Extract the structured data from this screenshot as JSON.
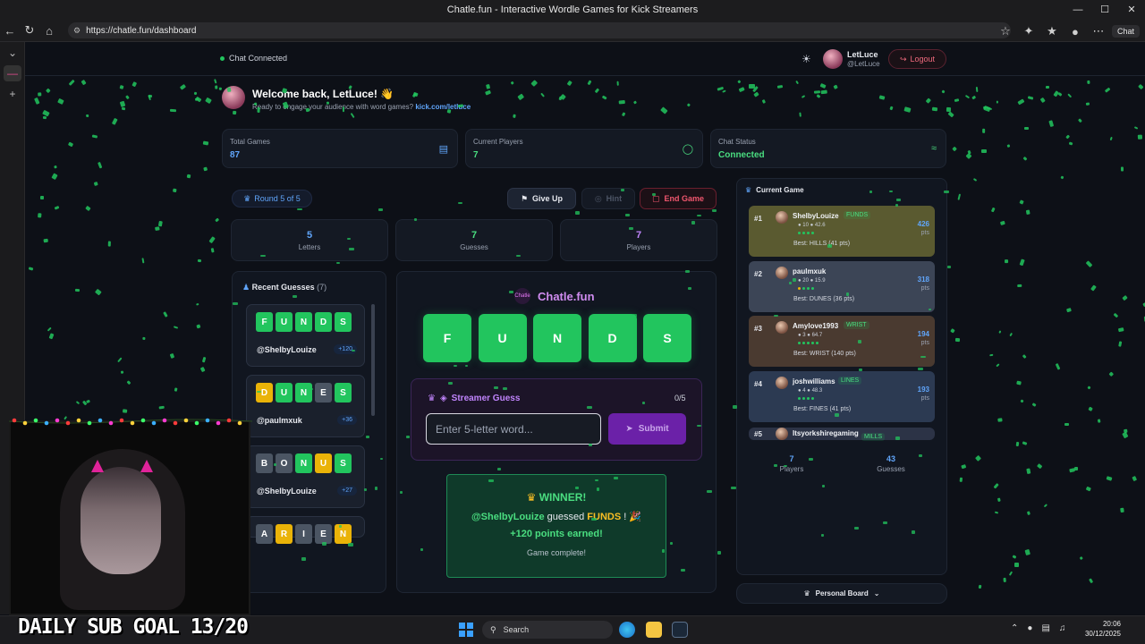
{
  "browser": {
    "window_title": "Chatle.fun - Interactive Wordle Games for Kick Streamers",
    "url": "https://chatle.fun/dashboard",
    "chat_button": "Chat",
    "window_controls": [
      "—",
      "☐",
      "✕"
    ]
  },
  "topbar": {
    "chat_status": "Chat Connected",
    "user_name": "LetLuce",
    "user_handle": "@LetLuce",
    "logout_label": "Logout"
  },
  "welcome": {
    "title": "Welcome back, LetLuce! 👋",
    "subtitle": "Ready to engage your audience with word games?",
    "link": "kick.com/letluce"
  },
  "stats": [
    {
      "label": "Total Games",
      "value": "87",
      "color": "#60a5fa"
    },
    {
      "label": "Current Players",
      "value": "7",
      "color": "#4ade80"
    },
    {
      "label": "Chat Status",
      "value": "Connected",
      "color": "#4ade80"
    }
  ],
  "round": {
    "label": "Round 5 of 5"
  },
  "actions": {
    "give_up": "Give Up",
    "hint": "Hint",
    "end_game": "End Game"
  },
  "summary": [
    {
      "value": "5",
      "label": "Letters",
      "color": "#60a5fa"
    },
    {
      "value": "7",
      "label": "Guesses",
      "color": "#4ade80"
    },
    {
      "value": "7",
      "label": "Players",
      "color": "#c084fc"
    }
  ],
  "recent": {
    "title": "Recent Guesses",
    "count": "(7)",
    "guesses": [
      {
        "letters": [
          "F",
          "U",
          "N",
          "D",
          "S"
        ],
        "states": [
          "g",
          "g",
          "g",
          "g",
          "g"
        ],
        "user": "@ShelbyLouize",
        "points": "+120"
      },
      {
        "letters": [
          "D",
          "U",
          "N",
          "E",
          "S"
        ],
        "states": [
          "y",
          "g",
          "g",
          "x",
          "g"
        ],
        "user": "@paulmxuk",
        "points": "+36"
      },
      {
        "letters": [
          "B",
          "O",
          "N",
          "U",
          "S"
        ],
        "states": [
          "x",
          "x",
          "g",
          "y",
          "g"
        ],
        "user": "@ShelbyLouize",
        "points": "+27"
      },
      {
        "letters": [
          "A",
          "R",
          "I",
          "E",
          "N"
        ],
        "states": [
          "x",
          "y",
          "x",
          "x",
          "y"
        ],
        "user": "",
        "points": ""
      }
    ]
  },
  "game": {
    "brand": "Chatle.fun",
    "brand_icon": "Chatle",
    "answer": [
      "F",
      "U",
      "N",
      "D",
      "S"
    ],
    "streamer_guess_title": "Streamer Guess",
    "streamer_guess_count": "0/5",
    "input_placeholder": "Enter 5-letter word...",
    "submit_label": "Submit",
    "winner_title": "WINNER!",
    "winner_user": "@ShelbyLouize",
    "winner_mid": "guessed",
    "winner_word": "FUNDS",
    "winner_tail": "! 🎉",
    "winner_points": "+120 points earned!",
    "winner_status": "Game complete!"
  },
  "current_game": {
    "title": "Current Game",
    "players": [
      {
        "rank": "#1",
        "name": "ShelbyLouize",
        "tag": "FUNDS",
        "stats": "● 10  ● 42.6",
        "best": "Best: HILLS (41 pts)",
        "points": "426",
        "unit": "pts",
        "bg": "#5a5a30",
        "dots": [
          "g",
          "g",
          "g",
          "g"
        ]
      },
      {
        "rank": "#2",
        "name": "paulmxuk",
        "tag": "",
        "stats": "● 20  ● 15.9",
        "best": "Best: DUNES (36 pts)",
        "points": "318",
        "unit": "pts",
        "bg": "#3c4556",
        "dots": [
          "y",
          "g",
          "g",
          "g"
        ]
      },
      {
        "rank": "#3",
        "name": "Amylove1993",
        "tag": "WRIST",
        "stats": "● 3  ● 64.7",
        "best": "Best: WRIST (140 pts)",
        "points": "194",
        "unit": "pts",
        "bg": "#4a3a30",
        "dots": [
          "g",
          "g",
          "g",
          "g",
          "g"
        ]
      },
      {
        "rank": "#4",
        "name": "joshwilliams",
        "tag": "LINES",
        "stats": "● 4  ● 48.3",
        "best": "Best: FINES (41 pts)",
        "points": "193",
        "unit": "pts",
        "bg": "#2c3a52",
        "dots": [
          "g",
          "g",
          "g",
          "g"
        ]
      },
      {
        "rank": "#5",
        "name": "Itsyorkshiregaming",
        "tag": "MILLS",
        "stats": "",
        "best": "",
        "points": "",
        "unit": "",
        "bg": "#2c3346",
        "dots": []
      }
    ],
    "footer_players_value": "7",
    "footer_players_label": "Players",
    "footer_guesses_value": "43",
    "footer_guesses_label": "Guesses"
  },
  "personal_board": "Personal Board",
  "overlay": {
    "sub_goal": "DAILY SUB GOAL 13/20"
  },
  "taskbar": {
    "search_label": "Search",
    "time": "20:06",
    "date": "30/12/2025"
  },
  "colors": {
    "accent_green": "#22c55e",
    "accent_purple": "#c084fc",
    "accent_blue": "#60a5fa",
    "danger": "#f0566e"
  }
}
